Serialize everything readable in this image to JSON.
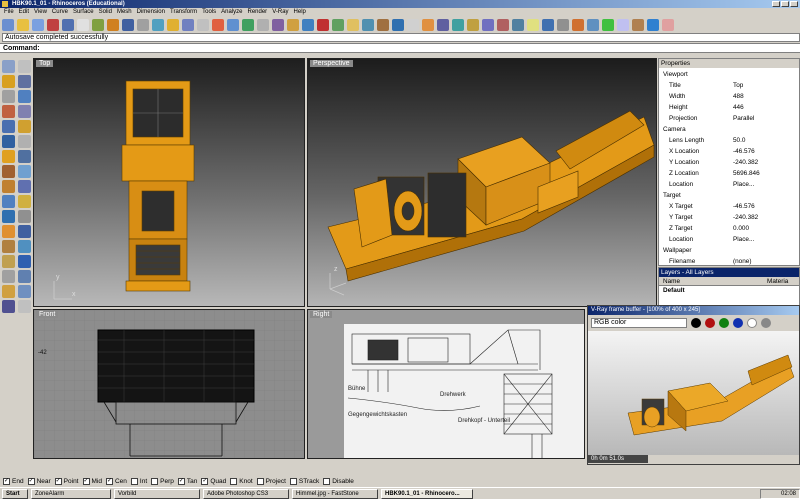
{
  "window": {
    "title": "HBK90.1_01 - Rhinoceros (Educational)"
  },
  "menu": [
    "File",
    "Edit",
    "View",
    "Curve",
    "Surface",
    "Solid",
    "Mesh",
    "Dimension",
    "Transform",
    "Tools",
    "Analyze",
    "Render",
    "V-Ray",
    "Help"
  ],
  "status": {
    "message": "Autosave completed successfully"
  },
  "command": {
    "label": "Command:"
  },
  "viewports": {
    "top": "Top",
    "perspective": "Perspective",
    "front": "Front",
    "right": "Right"
  },
  "properties": {
    "title": "Properties",
    "viewport_section": "Viewport",
    "fields": [
      {
        "k": "Title",
        "v": "Top"
      },
      {
        "k": "Width",
        "v": "488"
      },
      {
        "k": "Height",
        "v": "446"
      },
      {
        "k": "Projection",
        "v": "Parallel"
      }
    ],
    "camera_section": "Camera",
    "camera": [
      {
        "k": "Lens Length",
        "v": "50.0"
      },
      {
        "k": "X Location",
        "v": "-46.576"
      },
      {
        "k": "Y Location",
        "v": "-240.382"
      },
      {
        "k": "Z Location",
        "v": "5696.846"
      },
      {
        "k": "Location",
        "v": "Place..."
      }
    ],
    "target_section": "Target",
    "target": [
      {
        "k": "X Target",
        "v": "-46.576"
      },
      {
        "k": "Y Target",
        "v": "-240.382"
      },
      {
        "k": "Z Target",
        "v": "0.000"
      },
      {
        "k": "Location",
        "v": "Place..."
      }
    ],
    "wallpaper_section": "Wallpaper",
    "wallpaper": [
      {
        "k": "Filename",
        "v": "(none)"
      }
    ]
  },
  "layers": {
    "title": "Layers - All Layers",
    "col_name": "Name",
    "col_material": "Materia",
    "default_layer": "Default"
  },
  "vray": {
    "title": "V-Ray frame buffer - [100% of 400 x 245]",
    "channel": "RGB color",
    "time": "0h 0m 51.0s"
  },
  "drawing_labels": [
    "Bühne",
    "Gegengewichtskasten",
    "Drehwerk",
    "Drehkopf - Unterteil"
  ],
  "osnap": [
    {
      "label": "End",
      "on": true
    },
    {
      "label": "Near",
      "on": true
    },
    {
      "label": "Point",
      "on": true
    },
    {
      "label": "Mid",
      "on": true
    },
    {
      "label": "Cen",
      "on": true
    },
    {
      "label": "Int",
      "on": false
    },
    {
      "label": "Perp",
      "on": false
    },
    {
      "label": "Tan",
      "on": true
    },
    {
      "label": "Quad",
      "on": true
    },
    {
      "label": "Knot",
      "on": false
    },
    {
      "label": "Project",
      "on": false
    },
    {
      "label": "STrack",
      "on": false
    },
    {
      "label": "Disable",
      "on": false
    }
  ],
  "taskbar": {
    "start": "Start",
    "tasks": [
      "ZoneAlarm",
      "Vorbild",
      "Adobe Photoshop CS3",
      "Himmel.jpg - FastStone",
      "HBK90.1_01 - Rhinocero..."
    ],
    "clock": "02:08"
  }
}
